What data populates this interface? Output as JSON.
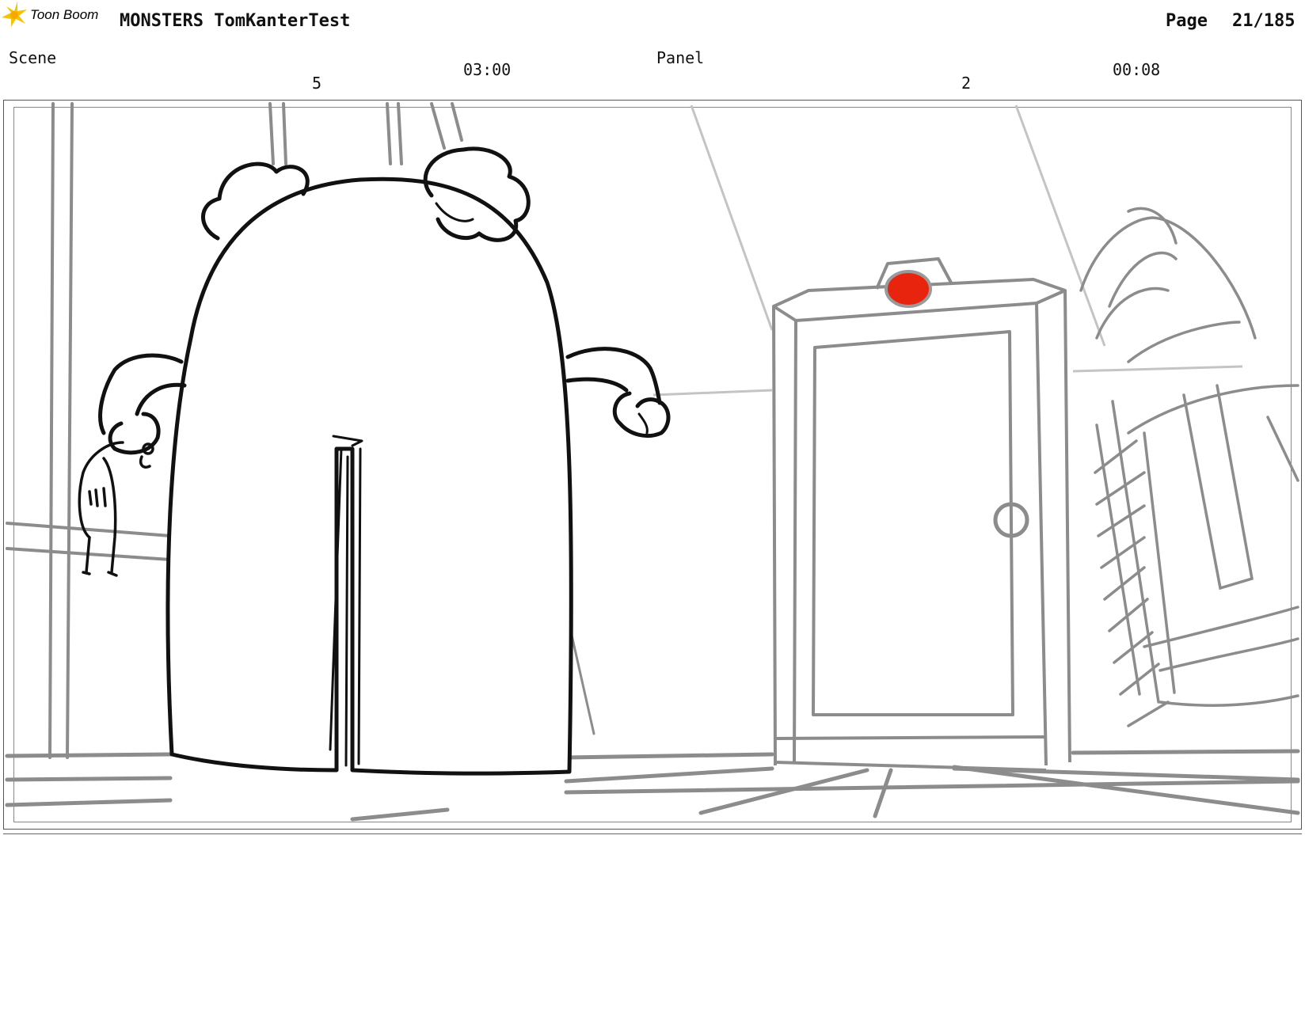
{
  "header": {
    "logo_text": "Toon Boom",
    "project_title": "MONSTERS TomKanterTest",
    "page_label": "Page",
    "page_number": "21/185"
  },
  "info_row": {
    "scene_label": "Scene",
    "scene_number": "5",
    "scene_duration": "03:00",
    "panel_label": "Panel",
    "panel_number": "2",
    "panel_duration": "00:08"
  },
  "colors": {
    "ink": "#111111",
    "pencil_grey": "#8c8c8c",
    "light_grey": "#c4c4c4",
    "alarm_red": "#e8230e",
    "logo_yellow": "#f5c400"
  }
}
